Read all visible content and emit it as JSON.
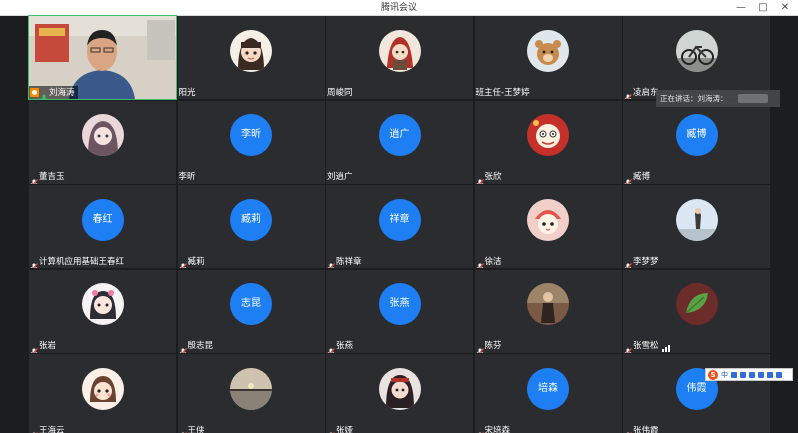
{
  "window": {
    "title": "腾讯会议"
  },
  "speaking": {
    "text": "正在讲话：刘海涛："
  },
  "ime": {
    "logo": "S",
    "mode": "中"
  },
  "tiles": [
    {
      "name": "刘海涛",
      "kind": "video"
    },
    {
      "name": "阳光",
      "kind": "avatar",
      "avatar": "girl-cartoon",
      "muted": false
    },
    {
      "name": "周峻同",
      "kind": "avatar",
      "avatar": "red-hood",
      "muted": false
    },
    {
      "name": "班主任-王梦婷",
      "kind": "avatar",
      "avatar": "bear-plush",
      "muted": false
    },
    {
      "name": "凌启东",
      "kind": "avatar",
      "avatar": "bicycle",
      "muted": true
    },
    {
      "name": "董吉玉",
      "kind": "avatar",
      "avatar": "anime-girl",
      "muted": true
    },
    {
      "name": "李昕",
      "kind": "initials",
      "initials": "李昕",
      "muted": false
    },
    {
      "name": "刘逍广",
      "kind": "initials",
      "initials": "逍广",
      "muted": false
    },
    {
      "name": "张欣",
      "kind": "avatar",
      "avatar": "cartoon-sheep",
      "muted": true
    },
    {
      "name": "臧博",
      "kind": "initials",
      "initials": "臧博",
      "muted": true
    },
    {
      "name": "计算机应用基础王春红",
      "kind": "initials",
      "initials": "春红",
      "muted": true
    },
    {
      "name": "臧莉",
      "kind": "initials",
      "initials": "臧莉",
      "muted": true
    },
    {
      "name": "陈祥章",
      "kind": "initials",
      "initials": "祥章",
      "muted": true
    },
    {
      "name": "徐洁",
      "kind": "avatar",
      "avatar": "cat-hat",
      "muted": true
    },
    {
      "name": "李梦梦",
      "kind": "avatar",
      "avatar": "sky-photo",
      "muted": true
    },
    {
      "name": "张岩",
      "kind": "avatar",
      "avatar": "pink-hair-girl",
      "muted": true
    },
    {
      "name": "殷志昆",
      "kind": "initials",
      "initials": "志昆",
      "muted": true
    },
    {
      "name": "张燕",
      "kind": "initials",
      "initials": "张燕",
      "muted": true
    },
    {
      "name": "陈芬",
      "kind": "avatar",
      "avatar": "person-photo",
      "muted": true
    },
    {
      "name": "张雪松",
      "kind": "avatar",
      "avatar": "green-leaf",
      "muted": true,
      "signal": true
    },
    {
      "name": "王海云",
      "kind": "avatar",
      "avatar": "cute-girl",
      "muted": true
    },
    {
      "name": "王侠",
      "kind": "avatar",
      "avatar": "sunset",
      "muted": true
    },
    {
      "name": "张娅",
      "kind": "avatar",
      "avatar": "dark-hair-girl",
      "muted": true
    },
    {
      "name": "宋培森",
      "kind": "initials",
      "initials": "培森",
      "muted": true
    },
    {
      "name": "张伟霞",
      "kind": "initials",
      "initials": "伟霞",
      "muted": true
    }
  ],
  "colors": {
    "tile_bg": "#2b2c2f",
    "initials_bg": "#1e7ff5",
    "host_badge": "#ff8a00",
    "mic_on": "#3cc06a",
    "mic_muted": "#e5483e"
  },
  "icons": {
    "minimize": "minimize-icon",
    "maximize": "maximize-icon",
    "close": "close-icon"
  }
}
